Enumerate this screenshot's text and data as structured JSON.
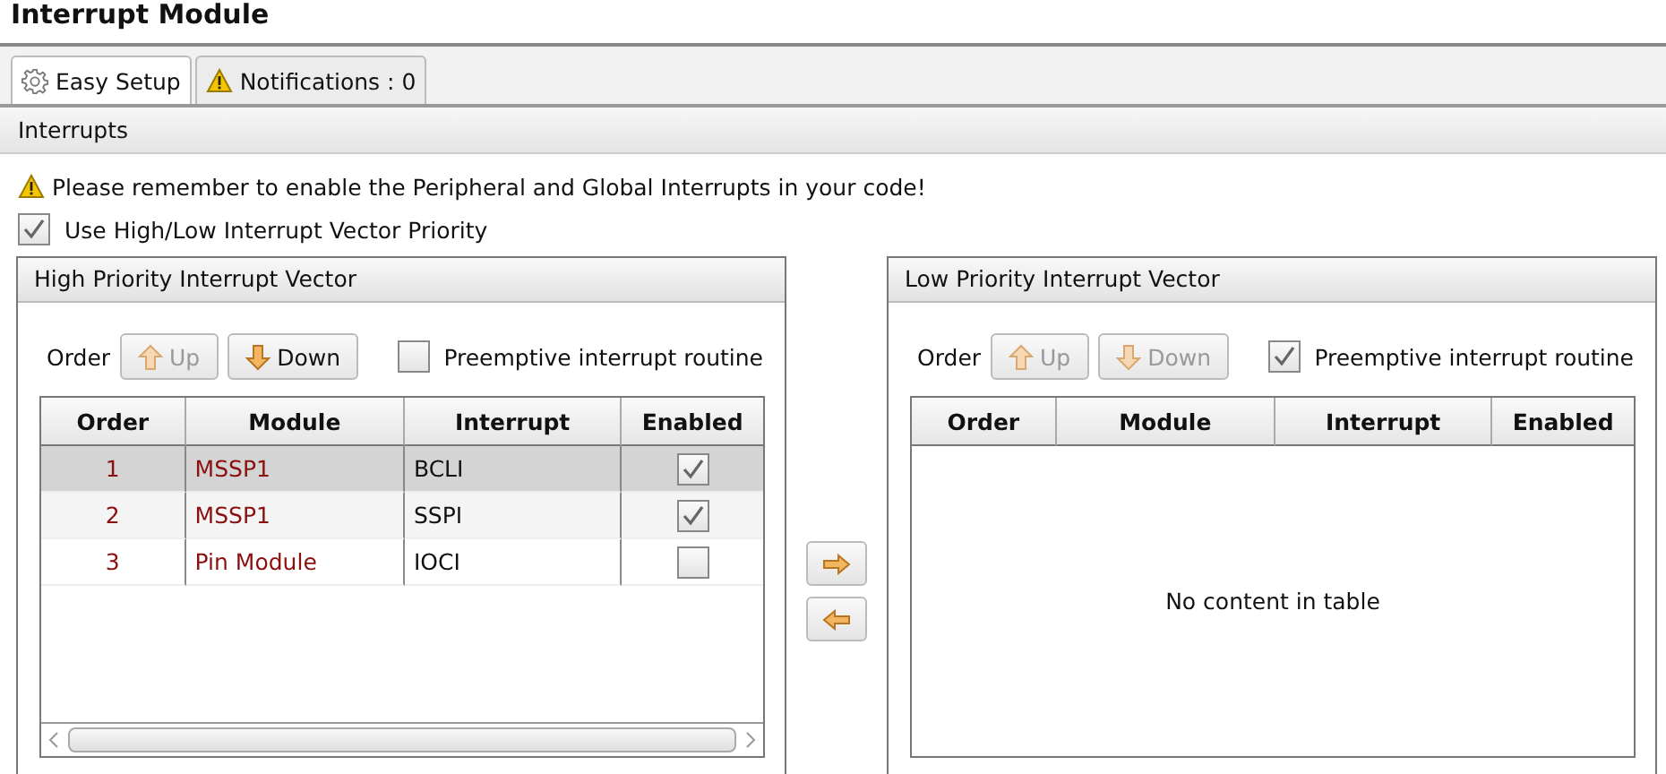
{
  "title": "Interrupt Module",
  "tabs": [
    {
      "label": "Easy Setup",
      "kind": "settings",
      "selected": true
    },
    {
      "label": "Notifications : 0",
      "kind": "warning",
      "selected": false
    }
  ],
  "section": "Interrupts",
  "warning": "Please remember to enable the Peripheral and Global Interrupts in your code!",
  "priority_option": {
    "label": "Use High/Low Interrupt Vector Priority",
    "checked": true
  },
  "panels": [
    {
      "title": "High Priority Interrupt Vector",
      "order_label": "Order",
      "buttons": [
        {
          "label": "Up",
          "kind": "up",
          "disabled": true
        },
        {
          "label": "Down",
          "kind": "down",
          "disabled": false
        }
      ],
      "preemptive": {
        "label": "Preemptive interrupt routine",
        "checked": false
      },
      "columns": [
        "Order",
        "Module",
        "Interrupt",
        "Enabled"
      ],
      "rows": [
        {
          "order": "1",
          "module": "MSSP1",
          "interrupt": "BCLI",
          "enabled": true,
          "selected": true
        },
        {
          "order": "2",
          "module": "MSSP1",
          "interrupt": "SSPI",
          "enabled": true,
          "selected": false
        },
        {
          "order": "3",
          "module": "Pin Module",
          "interrupt": "IOCI",
          "enabled": false,
          "selected": false
        }
      ]
    },
    {
      "title": "Low Priority Interrupt Vector",
      "order_label": "Order",
      "buttons": [
        {
          "label": "Up",
          "kind": "up",
          "disabled": true
        },
        {
          "label": "Down",
          "kind": "down",
          "disabled": true
        }
      ],
      "preemptive": {
        "label": "Preemptive interrupt routine",
        "checked": true
      },
      "columns": [
        "Order",
        "Module",
        "Interrupt",
        "Enabled"
      ],
      "empty_text": "No content in table"
    }
  ]
}
